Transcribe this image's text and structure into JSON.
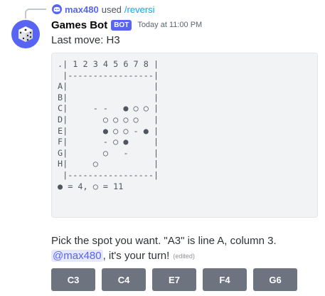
{
  "reply": {
    "username": "max480",
    "verb": "used",
    "command": "/reversi"
  },
  "message": {
    "author": "Games Bot",
    "badge": "BOT",
    "timestamp": "Today at 11:00 PM",
    "text": "Last move: H3",
    "board_lines": [
      ".| 1 2 3 4 5 6 7 8 |",
      " |-----------------|",
      "A|                 |",
      "B|                 |",
      "C|     - -   ● ○ ○ |",
      "D|       ○ ○ ○ ○   |",
      "E|       ● ○ ○ - ● |",
      "F|       - ○ ●     |",
      "G|       ○   -     |",
      "H|     ○           |",
      " |-----------------|",
      "● = 4, ○ = 11"
    ],
    "prompt": "Pick the spot you want. \"A3\" is line A, column 3.",
    "mention": "@max480",
    "turn_text": ", it's your turn!",
    "edited": "(edited)"
  },
  "buttons": [
    "C3",
    "C4",
    "E7",
    "F4",
    "G6"
  ],
  "colors": {
    "blurple": "#5865f2",
    "button_grey": "#6d7480",
    "codeblock_bg": "#f2f3f5",
    "command_blue": "#00a8fc"
  },
  "icons": {
    "reply_app_icon": "discord-icon",
    "avatar": "dice-icon"
  }
}
